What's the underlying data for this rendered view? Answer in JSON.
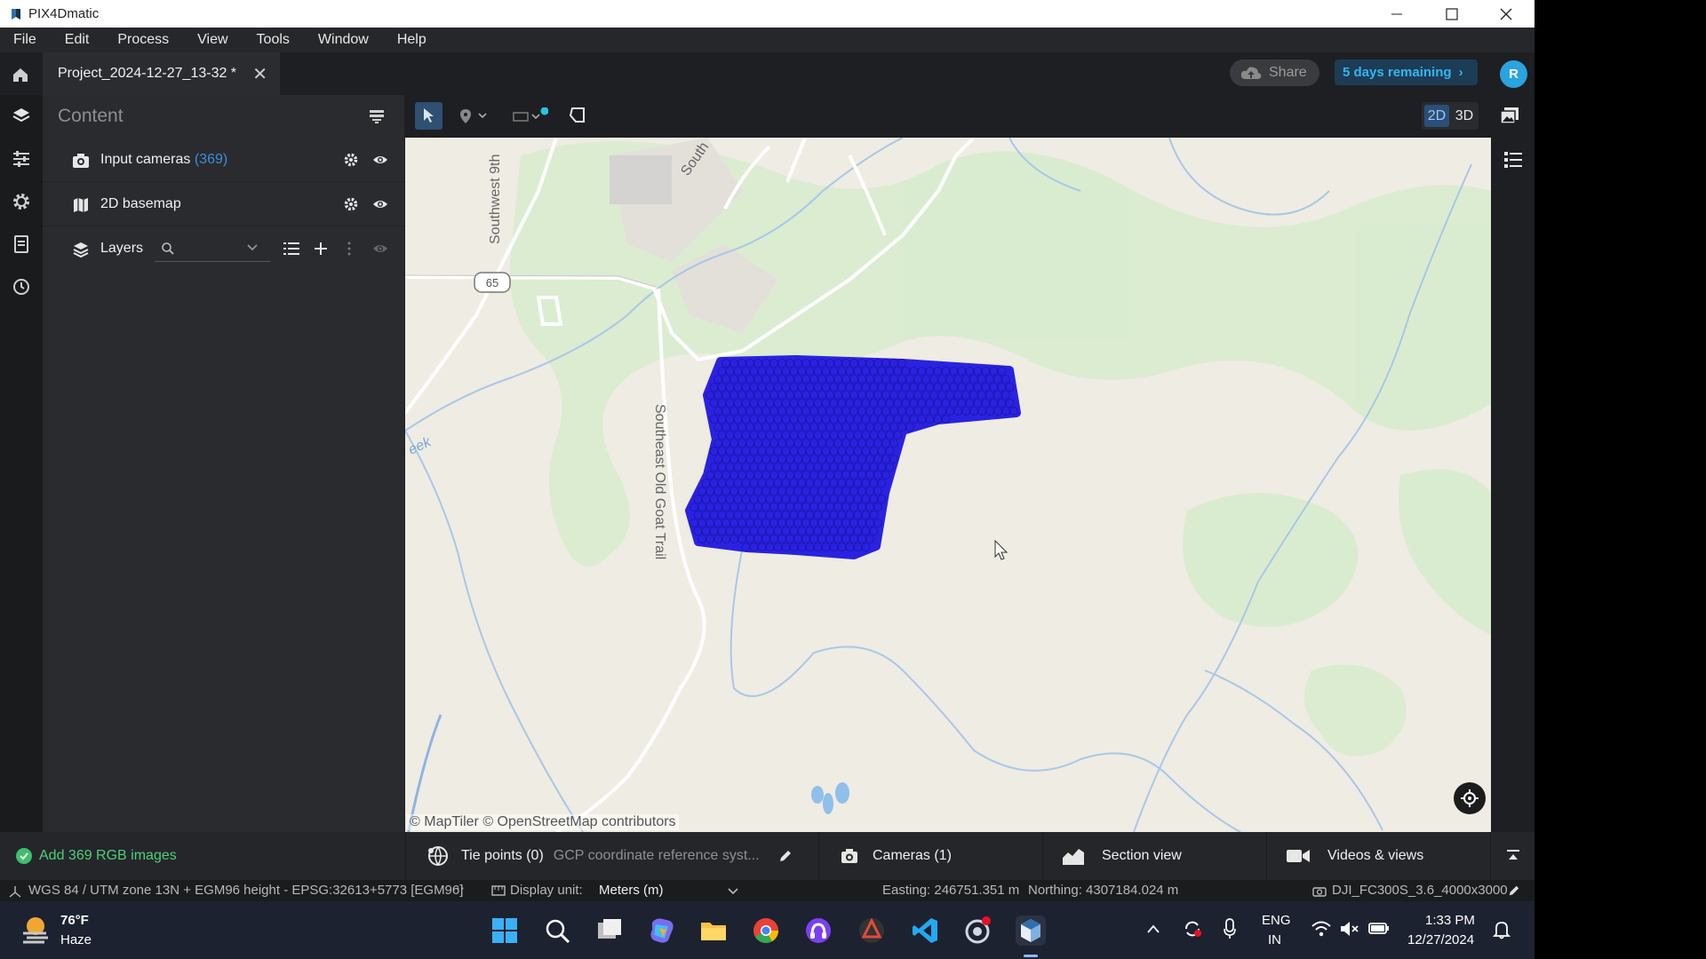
{
  "window": {
    "title": "PIX4Dmatic"
  },
  "menu": [
    "File",
    "Edit",
    "Process",
    "View",
    "Tools",
    "Window",
    "Help"
  ],
  "tab": {
    "label": "Project_2024-12-27_13-32 *"
  },
  "header": {
    "share": "Share",
    "trial": "5 days remaining",
    "avatar_initial": "R"
  },
  "panel": {
    "title": "Content",
    "items": [
      {
        "label": "Input cameras",
        "count": "(369)"
      },
      {
        "label": "2D basemap",
        "count": ""
      }
    ],
    "layers_label": "Layers"
  },
  "view_toggle": {
    "two_d": "2D",
    "three_d": "3D",
    "active": "2D"
  },
  "map": {
    "attribution": "© MapTiler  © OpenStreetMap contributors",
    "route_shield": "65",
    "road_labels": [
      "Southwest 9th",
      "Southeast Old Goat Trail",
      "South"
    ],
    "water_label": "eek",
    "camera_color": "#2a22e0"
  },
  "status": {
    "task": "Add 369 RGB images",
    "tie_points": "Tie points (0)",
    "gcp": "GCP coordinate reference syst...",
    "cameras": "Cameras (1)",
    "section": "Section view",
    "videos": "Videos & views"
  },
  "info": {
    "crs": "WGS 84 / UTM zone 13N + EGM96 height - EPSG:32613+5773 [EGM96]",
    "display_unit_label": "Display unit:",
    "display_unit_value": "Meters (m)",
    "easting": "Easting: 246751.351 m",
    "northing": "Northing: 4307184.024 m",
    "camera_model": "DJI_FC300S_3.6_4000x3000"
  },
  "taskbar": {
    "temp": "76°F",
    "weather": "Haze",
    "lang": "ENG",
    "region": "IN",
    "time": "1:33 PM",
    "date": "12/27/2024"
  }
}
